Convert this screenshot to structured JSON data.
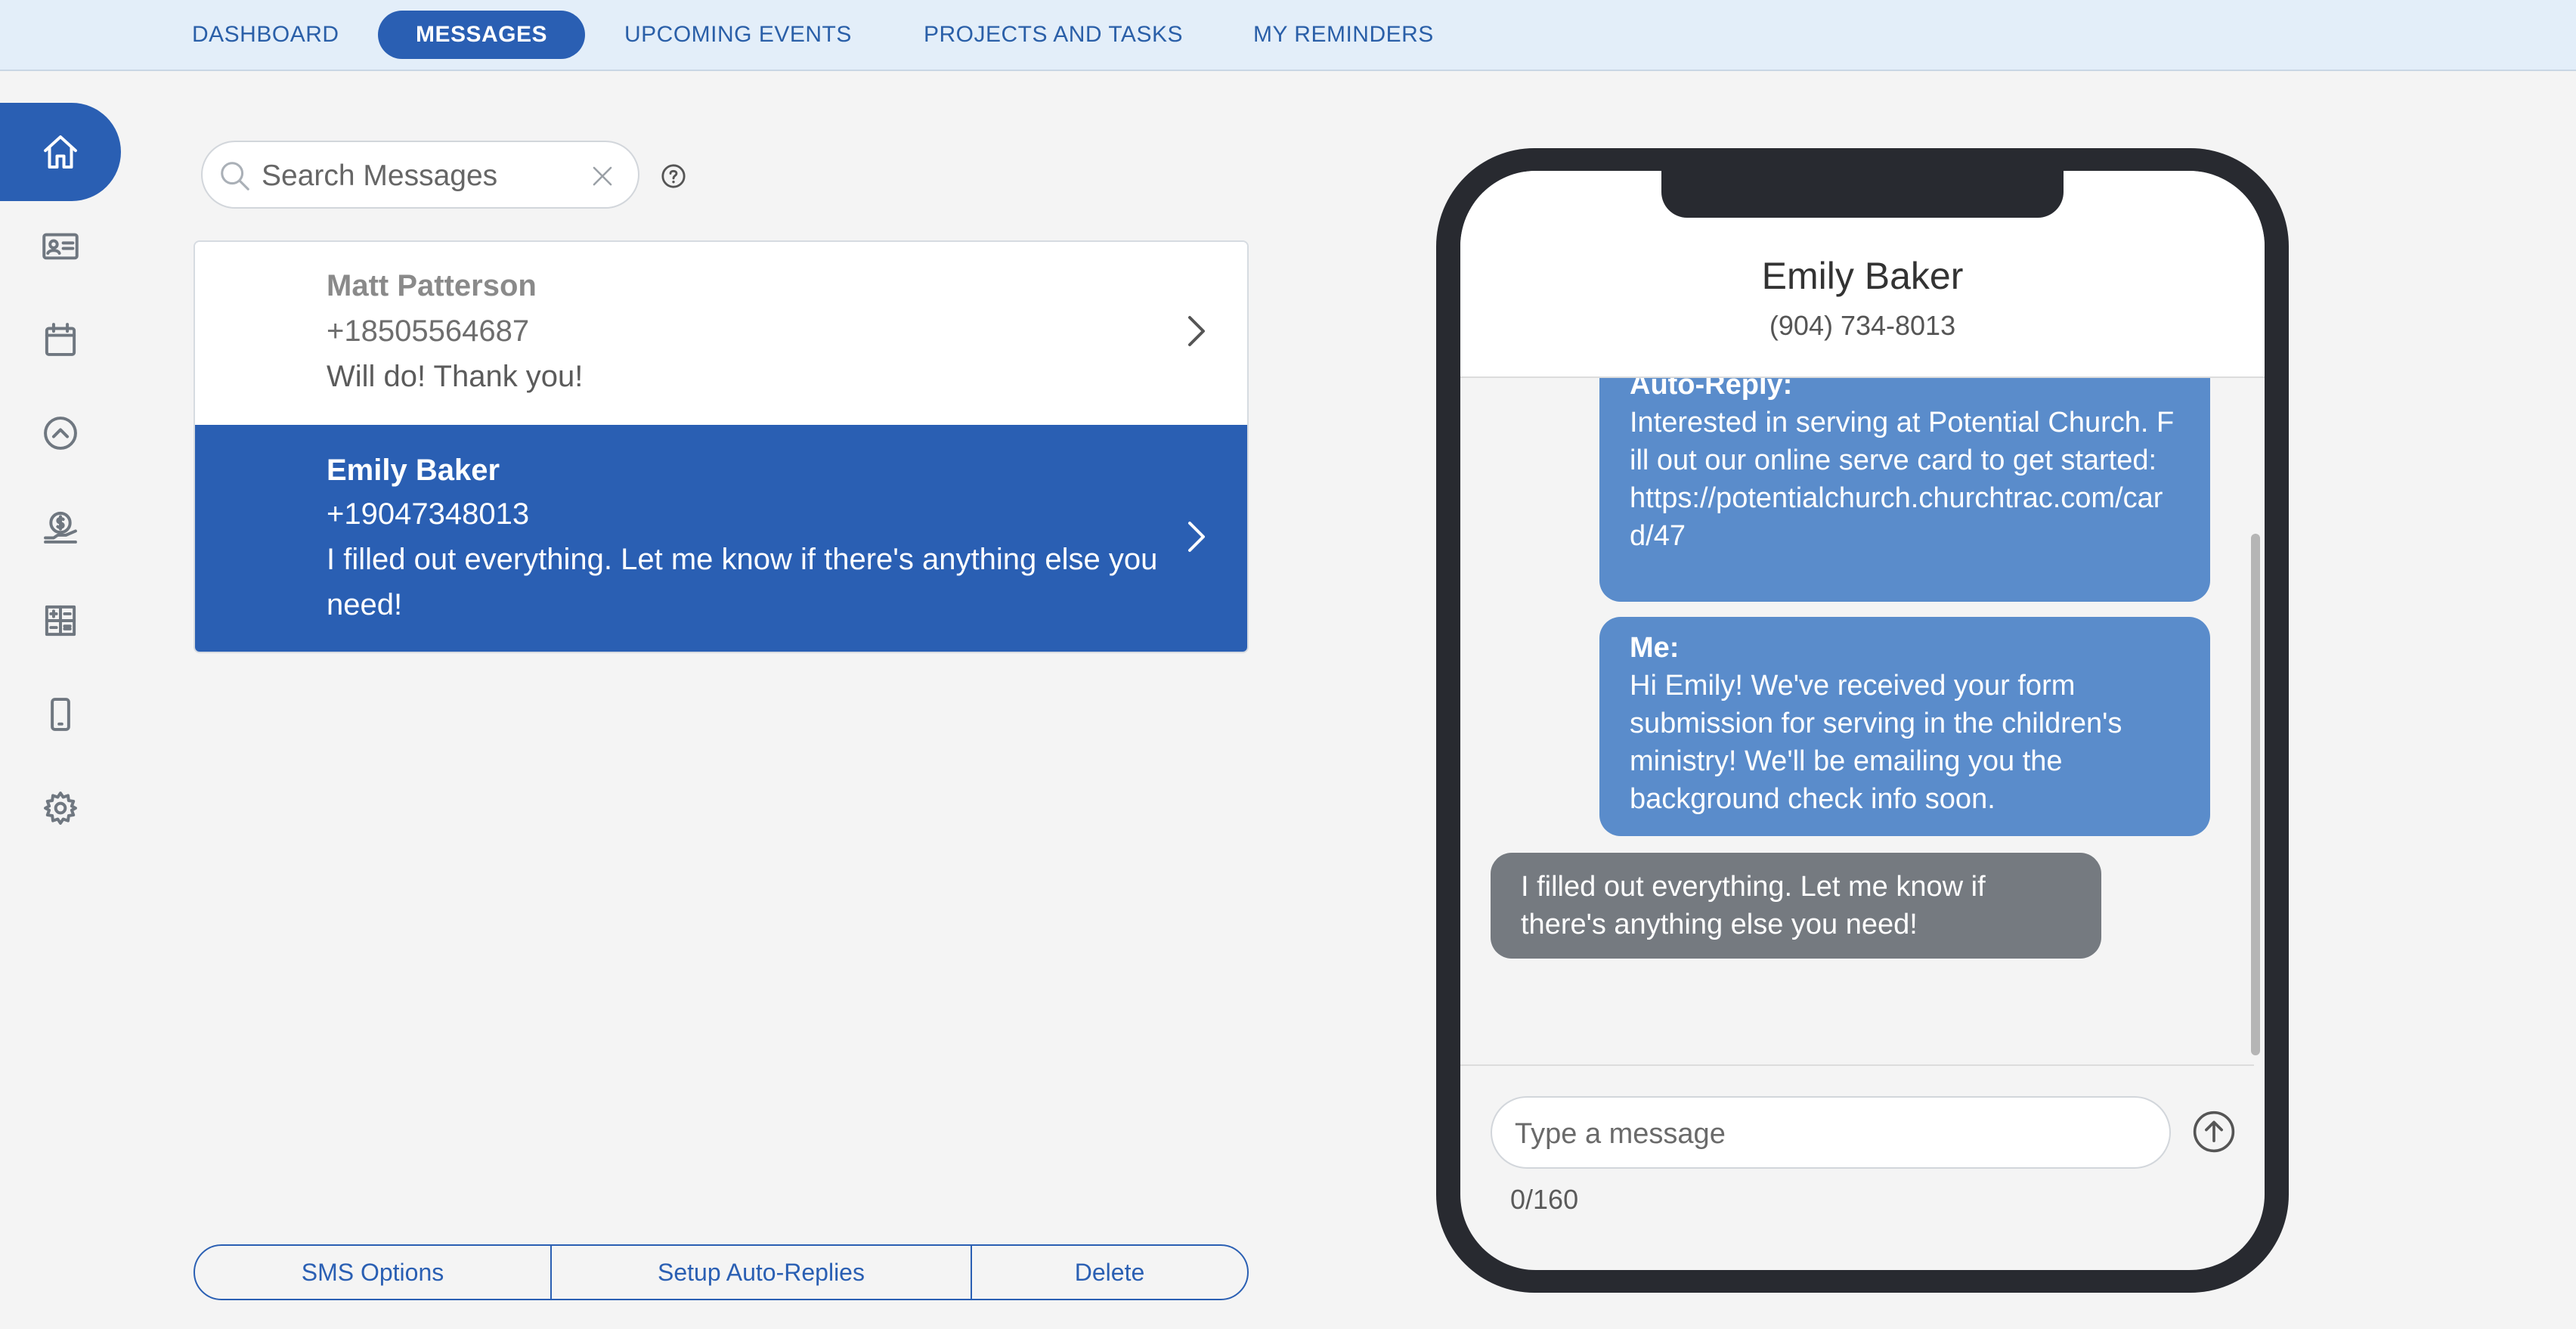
{
  "topnav": {
    "tabs": [
      {
        "label": "DASHBOARD"
      },
      {
        "label": "MESSAGES",
        "active": true
      },
      {
        "label": "UPCOMING EVENTS"
      },
      {
        "label": "PROJECTS AND TASKS"
      },
      {
        "label": "MY REMINDERS"
      }
    ]
  },
  "sidebar": {
    "items": [
      {
        "icon": "home-icon",
        "active": true
      },
      {
        "icon": "contact-card-icon"
      },
      {
        "icon": "calendar-icon"
      },
      {
        "icon": "chevron-up-circle-icon"
      },
      {
        "icon": "donation-icon"
      },
      {
        "icon": "calculator-icon"
      },
      {
        "icon": "mobile-phone-icon"
      },
      {
        "icon": "gear-icon"
      }
    ]
  },
  "search": {
    "placeholder": "Search Messages",
    "value": ""
  },
  "conversations": [
    {
      "name": "Matt Patterson",
      "phone": "+18505564687",
      "preview": "Will do! Thank you!"
    },
    {
      "name": "Emily Baker",
      "phone": "+19047348013",
      "preview": "I filled out everything. Let me know if there's anything else you need!"
    }
  ],
  "buttons": {
    "sms_options": "SMS Options",
    "setup_auto_replies": "Setup Auto-Replies",
    "delete": "Delete"
  },
  "chat": {
    "contact_name": "Emily Baker",
    "contact_phone": "(904) 734-8013",
    "messages": [
      {
        "sender": "Auto-Reply:",
        "text": "Interested in serving at Potential Church. Fill out our online serve card to get started: https://potentialchurch.churchtrac.com/card/47"
      },
      {
        "sender": "Me:",
        "text": "Hi Emily! We've received your form submission for serving in the children's ministry! We'll be emailing you the background check info soon."
      },
      {
        "sender": "",
        "text": "I filled out everything. Let me know if there's anything else you need!"
      }
    ],
    "compose_placeholder": "Type a message",
    "char_counter": "0/160"
  },
  "colors": {
    "accent": "#2a5fb3",
    "topnav_bg": "#e3eef9",
    "bubble_outgoing": "#5a8ccb",
    "bubble_incoming": "#757a80",
    "phone_frame": "#282a30"
  }
}
